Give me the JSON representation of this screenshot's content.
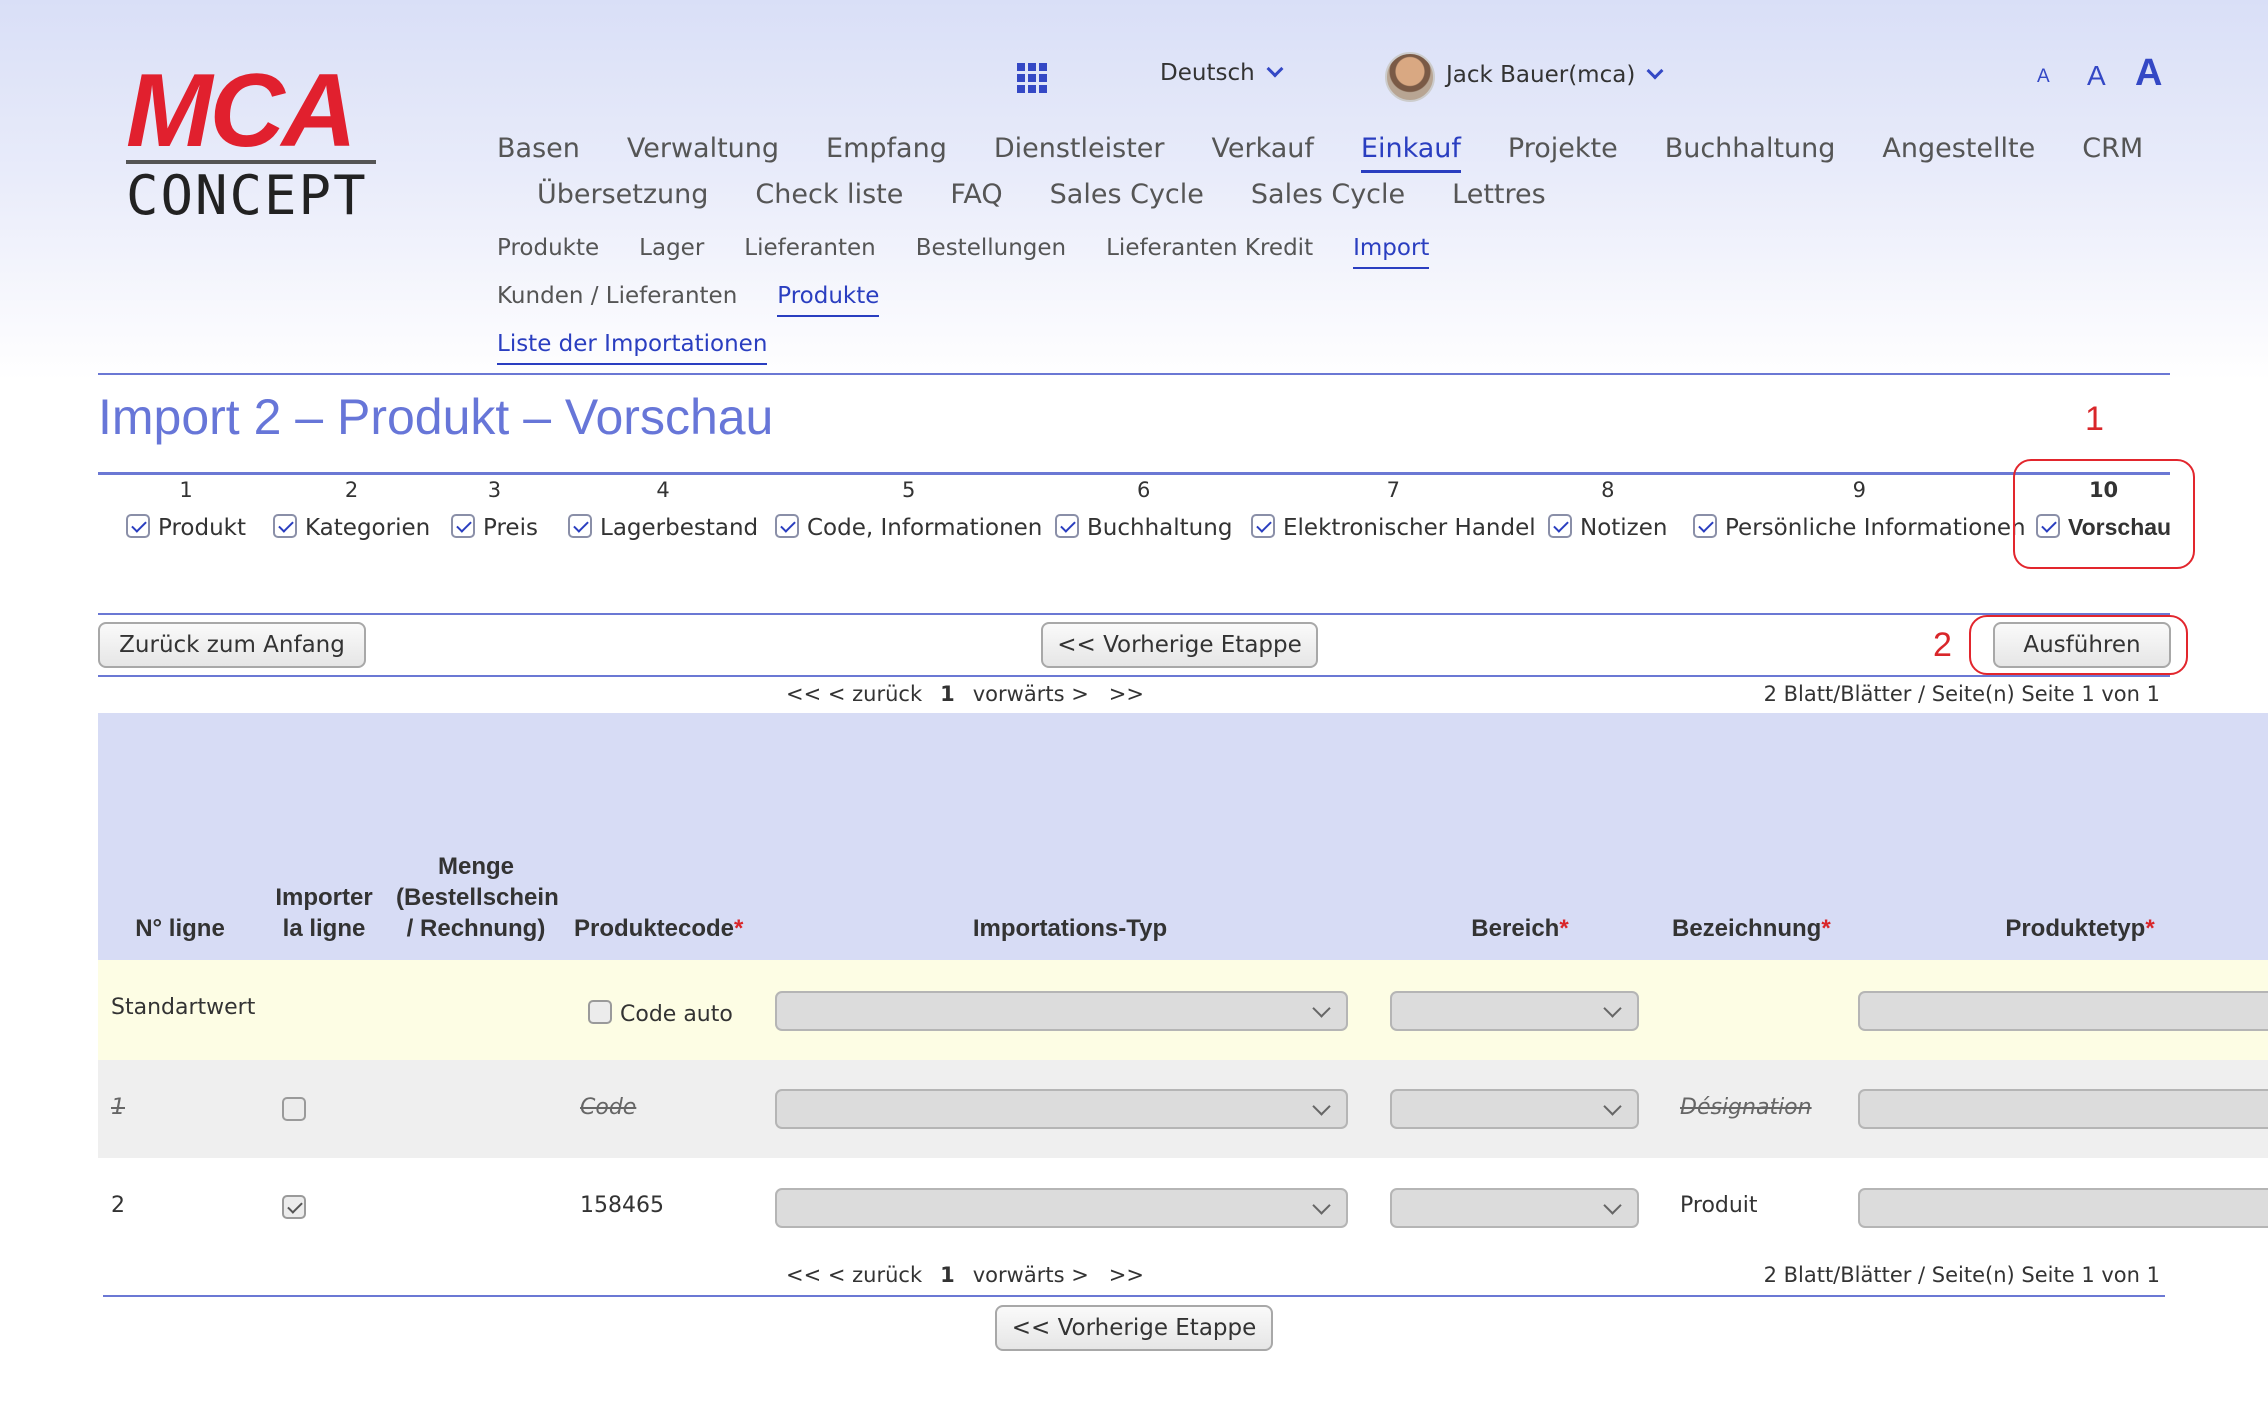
{
  "logo": {
    "top": "MCA",
    "bottom": "CONCEPT"
  },
  "header": {
    "apps_icon": "grid-icon",
    "language": "Deutsch",
    "user": "Jack Bauer(mca)",
    "font_sizes": [
      "A",
      "A",
      "A"
    ]
  },
  "menu": {
    "main_row1": [
      "Basen",
      "Verwaltung",
      "Empfang",
      "Dienstleister",
      "Verkauf",
      "Einkauf",
      "Projekte",
      "Buchhaltung",
      "Angestellte",
      "CRM"
    ],
    "main_row2": [
      "Übersetzung",
      "Check liste",
      "FAQ",
      "Sales Cycle",
      "Sales Cycle",
      "Lettres"
    ],
    "active_main": "Einkauf",
    "sub1": [
      "Produkte",
      "Lager",
      "Lieferanten",
      "Bestellungen",
      "Lieferanten Kredit",
      "Import"
    ],
    "sub2": [
      "Kunden / Lieferanten",
      "Produkte"
    ],
    "sub3": [
      "Liste der Importationen"
    ]
  },
  "page_title": "Import 2 – Produkt – Vorschau",
  "steps": [
    {
      "num": "1",
      "label": "Produkt"
    },
    {
      "num": "2",
      "label": "Kategorien"
    },
    {
      "num": "3",
      "label": "Preis"
    },
    {
      "num": "4",
      "label": "Lagerbestand"
    },
    {
      "num": "5",
      "label": "Code, Informationen"
    },
    {
      "num": "6",
      "label": "Buchhaltung"
    },
    {
      "num": "7",
      "label": "Elektronischer Handel"
    },
    {
      "num": "8",
      "label": "Notizen"
    },
    {
      "num": "9",
      "label": "Persönliche Informationen"
    },
    {
      "num": "10",
      "label": "Vorschau"
    }
  ],
  "annotations": {
    "one": "1",
    "two": "2"
  },
  "buttons": {
    "back_to_start": "Zurück zum Anfang",
    "previous_step": "<< Vorherige Etappe",
    "execute": "Ausführen"
  },
  "pager": {
    "prev": "<< < zurück",
    "page": "1",
    "next": "vorwärts >",
    "last": ">>",
    "info": "2 Blatt/Blätter / Seite(n) Seite 1 von 1"
  },
  "table": {
    "headers": {
      "line_no": "N° ligne",
      "import_line_1": "Importer",
      "import_line_2": "la ligne",
      "qty_1": "Menge",
      "qty_2": "(Bestellschein",
      "qty_3": "/ Rechnung)",
      "product_code": "Produktecode",
      "import_type": "Importations-Typ",
      "area": "Bereich",
      "designation": "Bezeichnung",
      "product_type": "Produktetyp",
      "required": "*"
    },
    "default_row": {
      "label": "Standartwert",
      "code_auto": "Code auto"
    },
    "rows": [
      {
        "line": "1",
        "checked": false,
        "code": "Code",
        "designation": "Désignation",
        "struck": true
      },
      {
        "line": "2",
        "checked": true,
        "code": "158465",
        "designation": "Produit",
        "struck": false
      }
    ]
  }
}
